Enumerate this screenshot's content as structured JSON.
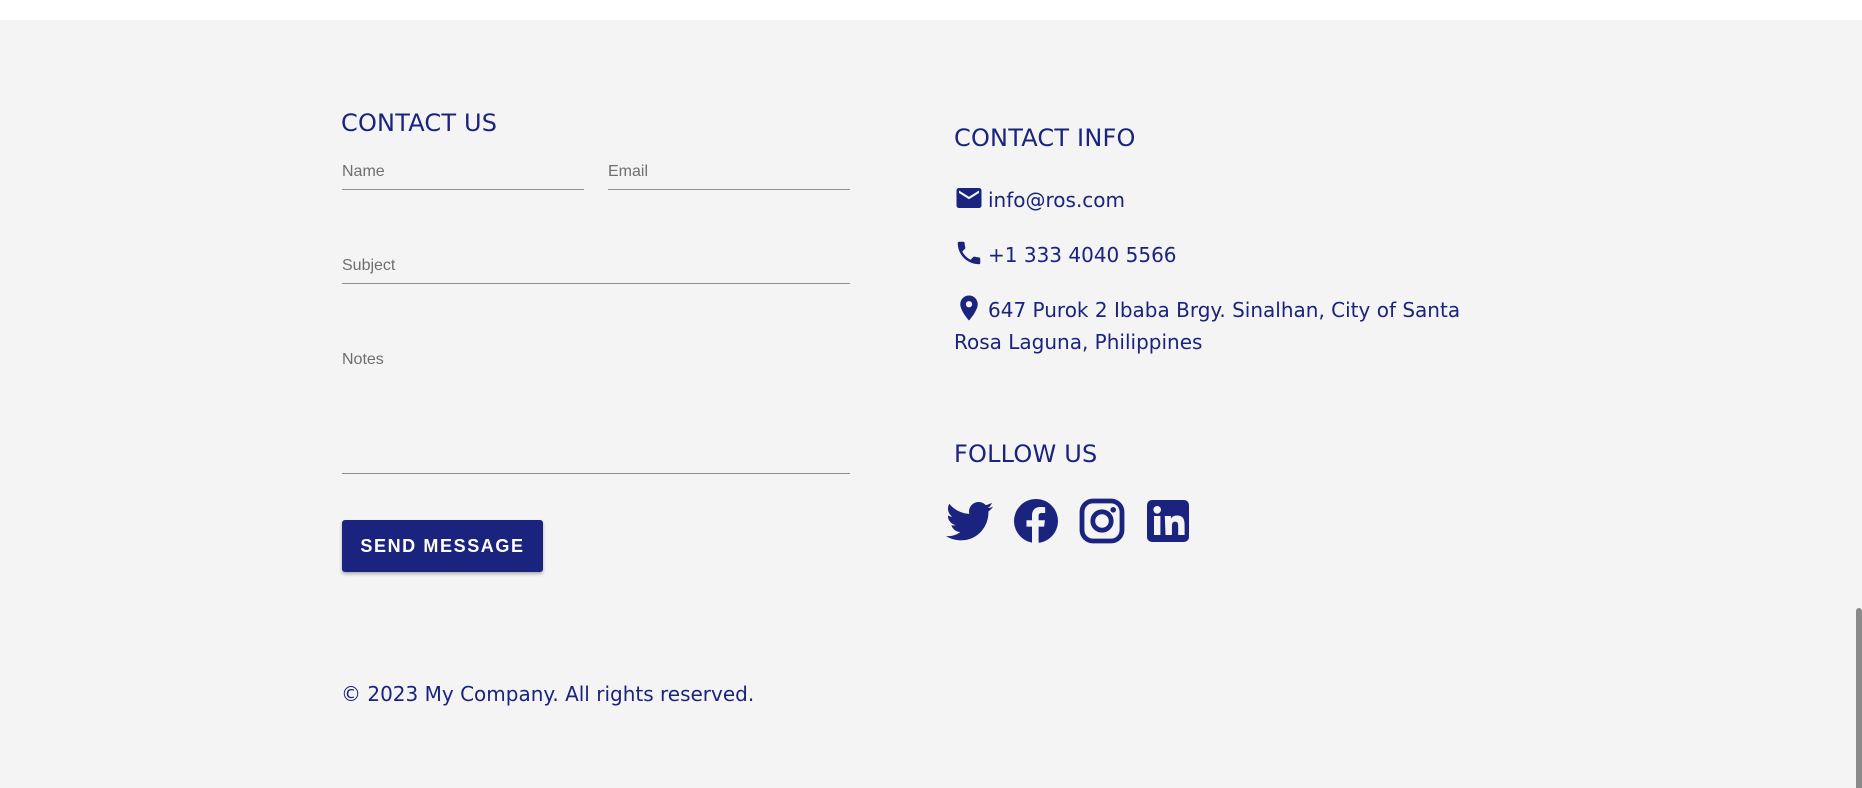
{
  "contact_form": {
    "title": "CONTACT US",
    "name_placeholder": "Name",
    "email_placeholder": "Email",
    "subject_placeholder": "Subject",
    "notes_placeholder": "Notes",
    "send_label": "SEND MESSAGE"
  },
  "contact_info": {
    "title": "CONTACT INFO",
    "email": "info@ros.com",
    "phone": "+1 333 4040 5566",
    "address": "647 Purok 2 Ibaba Brgy. Sinalhan, City of Santa Rosa Laguna, Philippines",
    "icons": [
      "email-icon",
      "phone-icon",
      "location-icon"
    ]
  },
  "follow_us": {
    "title": "FOLLOW US",
    "icons": [
      "twitter-icon",
      "facebook-icon",
      "instagram-icon",
      "linkedin-icon"
    ]
  },
  "footer": {
    "copyright": "© 2023 My Company. All rights reserved."
  },
  "colors": {
    "accent": "#1a237e",
    "background": "#f4f4f4"
  }
}
